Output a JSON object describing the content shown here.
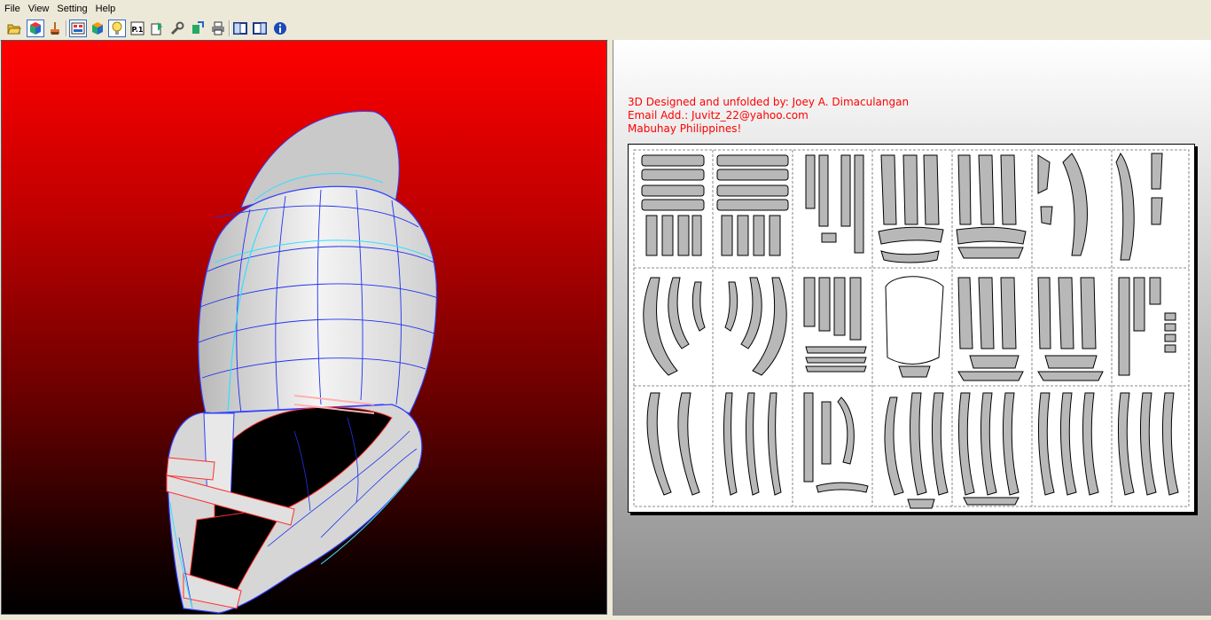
{
  "menu": [
    "File",
    "View",
    "Setting",
    "Help"
  ],
  "toolbar": {
    "icons": [
      "open-folder-icon",
      "3d-cube-icon",
      "brush-icon",
      "unfold-icon",
      "colored-cube-icon",
      "lightbulb-icon",
      "page-number-icon",
      "edit-page-icon",
      "wrench-icon",
      "export-icon",
      "print-icon",
      "single-view-icon",
      "dual-view-icon",
      "info-icon"
    ],
    "page_label": "P.1"
  },
  "credits": {
    "line1": "3D Designed and unfolded by: Joey A. Dimaculangan",
    "line2": "Email Add.: Juvitz_22@yahoo.com",
    "line3": "Mabuhay Philippines!"
  },
  "colors": {
    "background_top": "#ff0000",
    "background_bottom": "#000000",
    "credit_text": "#ff0000",
    "mesh_edge": "#0000ff",
    "seam_edge": "#00e5ff"
  }
}
